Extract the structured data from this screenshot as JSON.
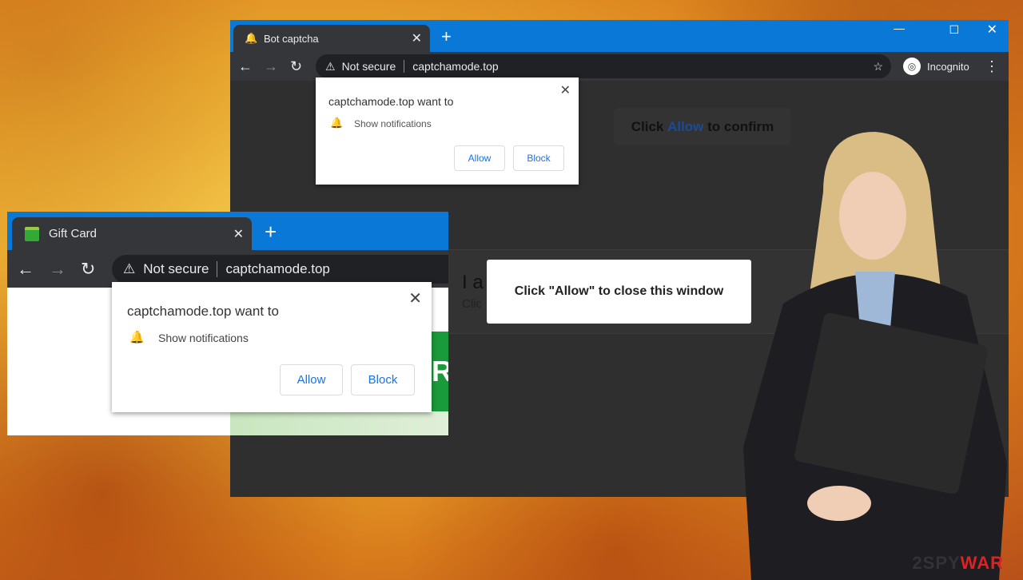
{
  "back_window": {
    "tab_title": "Bot captcha",
    "tab_icon": "bell-icon",
    "not_secure": "Not secure",
    "url": "captchamode.top",
    "profile": "Incognito",
    "popup": {
      "title": "captchamode.top want to",
      "permission": "Show notifications",
      "allow": "Allow",
      "block": "Block"
    },
    "confirm": {
      "prefix": "Click ",
      "highlight": "Allow",
      "suffix": " to confirm"
    },
    "page_heading_partial": "I a",
    "page_sub_partial": "Clic",
    "close_box": "Click \"Allow\" to close this window"
  },
  "front_window": {
    "tab_title": "Gift Card",
    "tab_icon": "gift-icon",
    "not_secure": "Not secure",
    "url": "captchamode.top",
    "popup": {
      "title": "captchamode.top want to",
      "permission": "Show notifications",
      "allow": "Allow",
      "block": "Block"
    },
    "green_letter": "R"
  },
  "watermark": "2SPYWAR",
  "colors": {
    "tab_bar": "#0a78d6",
    "chrome_dark": "#35363a",
    "link_blue": "#1a73e8",
    "watermark_red": "#d22"
  }
}
